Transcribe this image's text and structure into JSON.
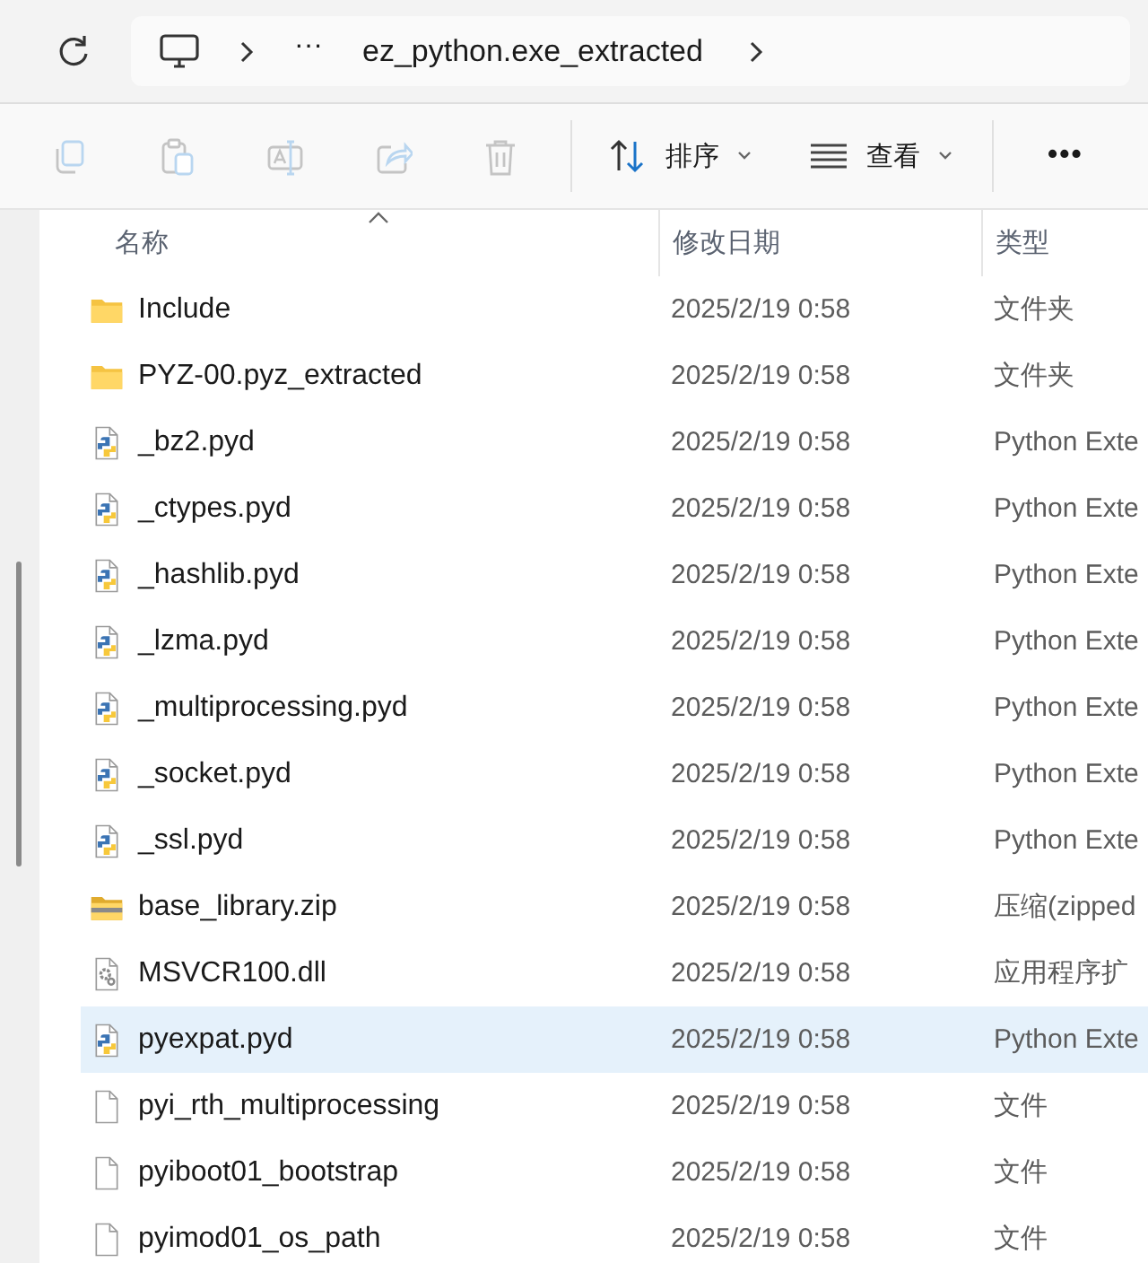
{
  "address_bar": {
    "ellipsis": "···",
    "path": "ez_python.exe_extracted"
  },
  "toolbar": {
    "icon_buttons": [
      {
        "kind": "copy",
        "disabled": true
      },
      {
        "kind": "paste",
        "disabled": true
      },
      {
        "kind": "rename",
        "disabled": true
      },
      {
        "kind": "share",
        "disabled": true
      },
      {
        "kind": "delete",
        "disabled": true
      }
    ],
    "menus": [
      {
        "kind": "sort",
        "label": "排序"
      },
      {
        "kind": "view",
        "label": "查看"
      }
    ],
    "more": "•••"
  },
  "table": {
    "columns": [
      {
        "label": "名称",
        "sorted": true
      },
      {
        "label": "修改日期",
        "sorted": false
      },
      {
        "label": "类型",
        "sorted": false
      }
    ],
    "rows": [
      {
        "kind": "folder",
        "name": "Include",
        "modified": "2025/2/19 0:58",
        "type": "文件夹",
        "selected": false
      },
      {
        "kind": "folder",
        "name": "PYZ-00.pyz_extracted",
        "modified": "2025/2/19 0:58",
        "type": "文件夹",
        "selected": false
      },
      {
        "kind": "python",
        "name": "_bz2.pyd",
        "modified": "2025/2/19 0:58",
        "type": "Python Exte",
        "selected": false
      },
      {
        "kind": "python",
        "name": "_ctypes.pyd",
        "modified": "2025/2/19 0:58",
        "type": "Python Exte",
        "selected": false
      },
      {
        "kind": "python",
        "name": "_hashlib.pyd",
        "modified": "2025/2/19 0:58",
        "type": "Python Exte",
        "selected": false
      },
      {
        "kind": "python",
        "name": "_lzma.pyd",
        "modified": "2025/2/19 0:58",
        "type": "Python Exte",
        "selected": false
      },
      {
        "kind": "python",
        "name": "_multiprocessing.pyd",
        "modified": "2025/2/19 0:58",
        "type": "Python Exte",
        "selected": false
      },
      {
        "kind": "python",
        "name": "_socket.pyd",
        "modified": "2025/2/19 0:58",
        "type": "Python Exte",
        "selected": false
      },
      {
        "kind": "python",
        "name": "_ssl.pyd",
        "modified": "2025/2/19 0:58",
        "type": "Python Exte",
        "selected": false
      },
      {
        "kind": "zip",
        "name": "base_library.zip",
        "modified": "2025/2/19 0:58",
        "type": "压缩(zipped",
        "selected": false
      },
      {
        "kind": "dll",
        "name": "MSVCR100.dll",
        "modified": "2025/2/19 0:58",
        "type": "应用程序扩",
        "selected": false
      },
      {
        "kind": "python",
        "name": "pyexpat.pyd",
        "modified": "2025/2/19 0:58",
        "type": "Python Exte",
        "selected": true
      },
      {
        "kind": "file",
        "name": "pyi_rth_multiprocessing",
        "modified": "2025/2/19 0:58",
        "type": "文件",
        "selected": false
      },
      {
        "kind": "file",
        "name": "pyiboot01_bootstrap",
        "modified": "2025/2/19 0:58",
        "type": "文件",
        "selected": false
      },
      {
        "kind": "file",
        "name": "pyimod01_os_path",
        "modified": "2025/2/19 0:58",
        "type": "文件",
        "selected": false
      }
    ]
  }
}
